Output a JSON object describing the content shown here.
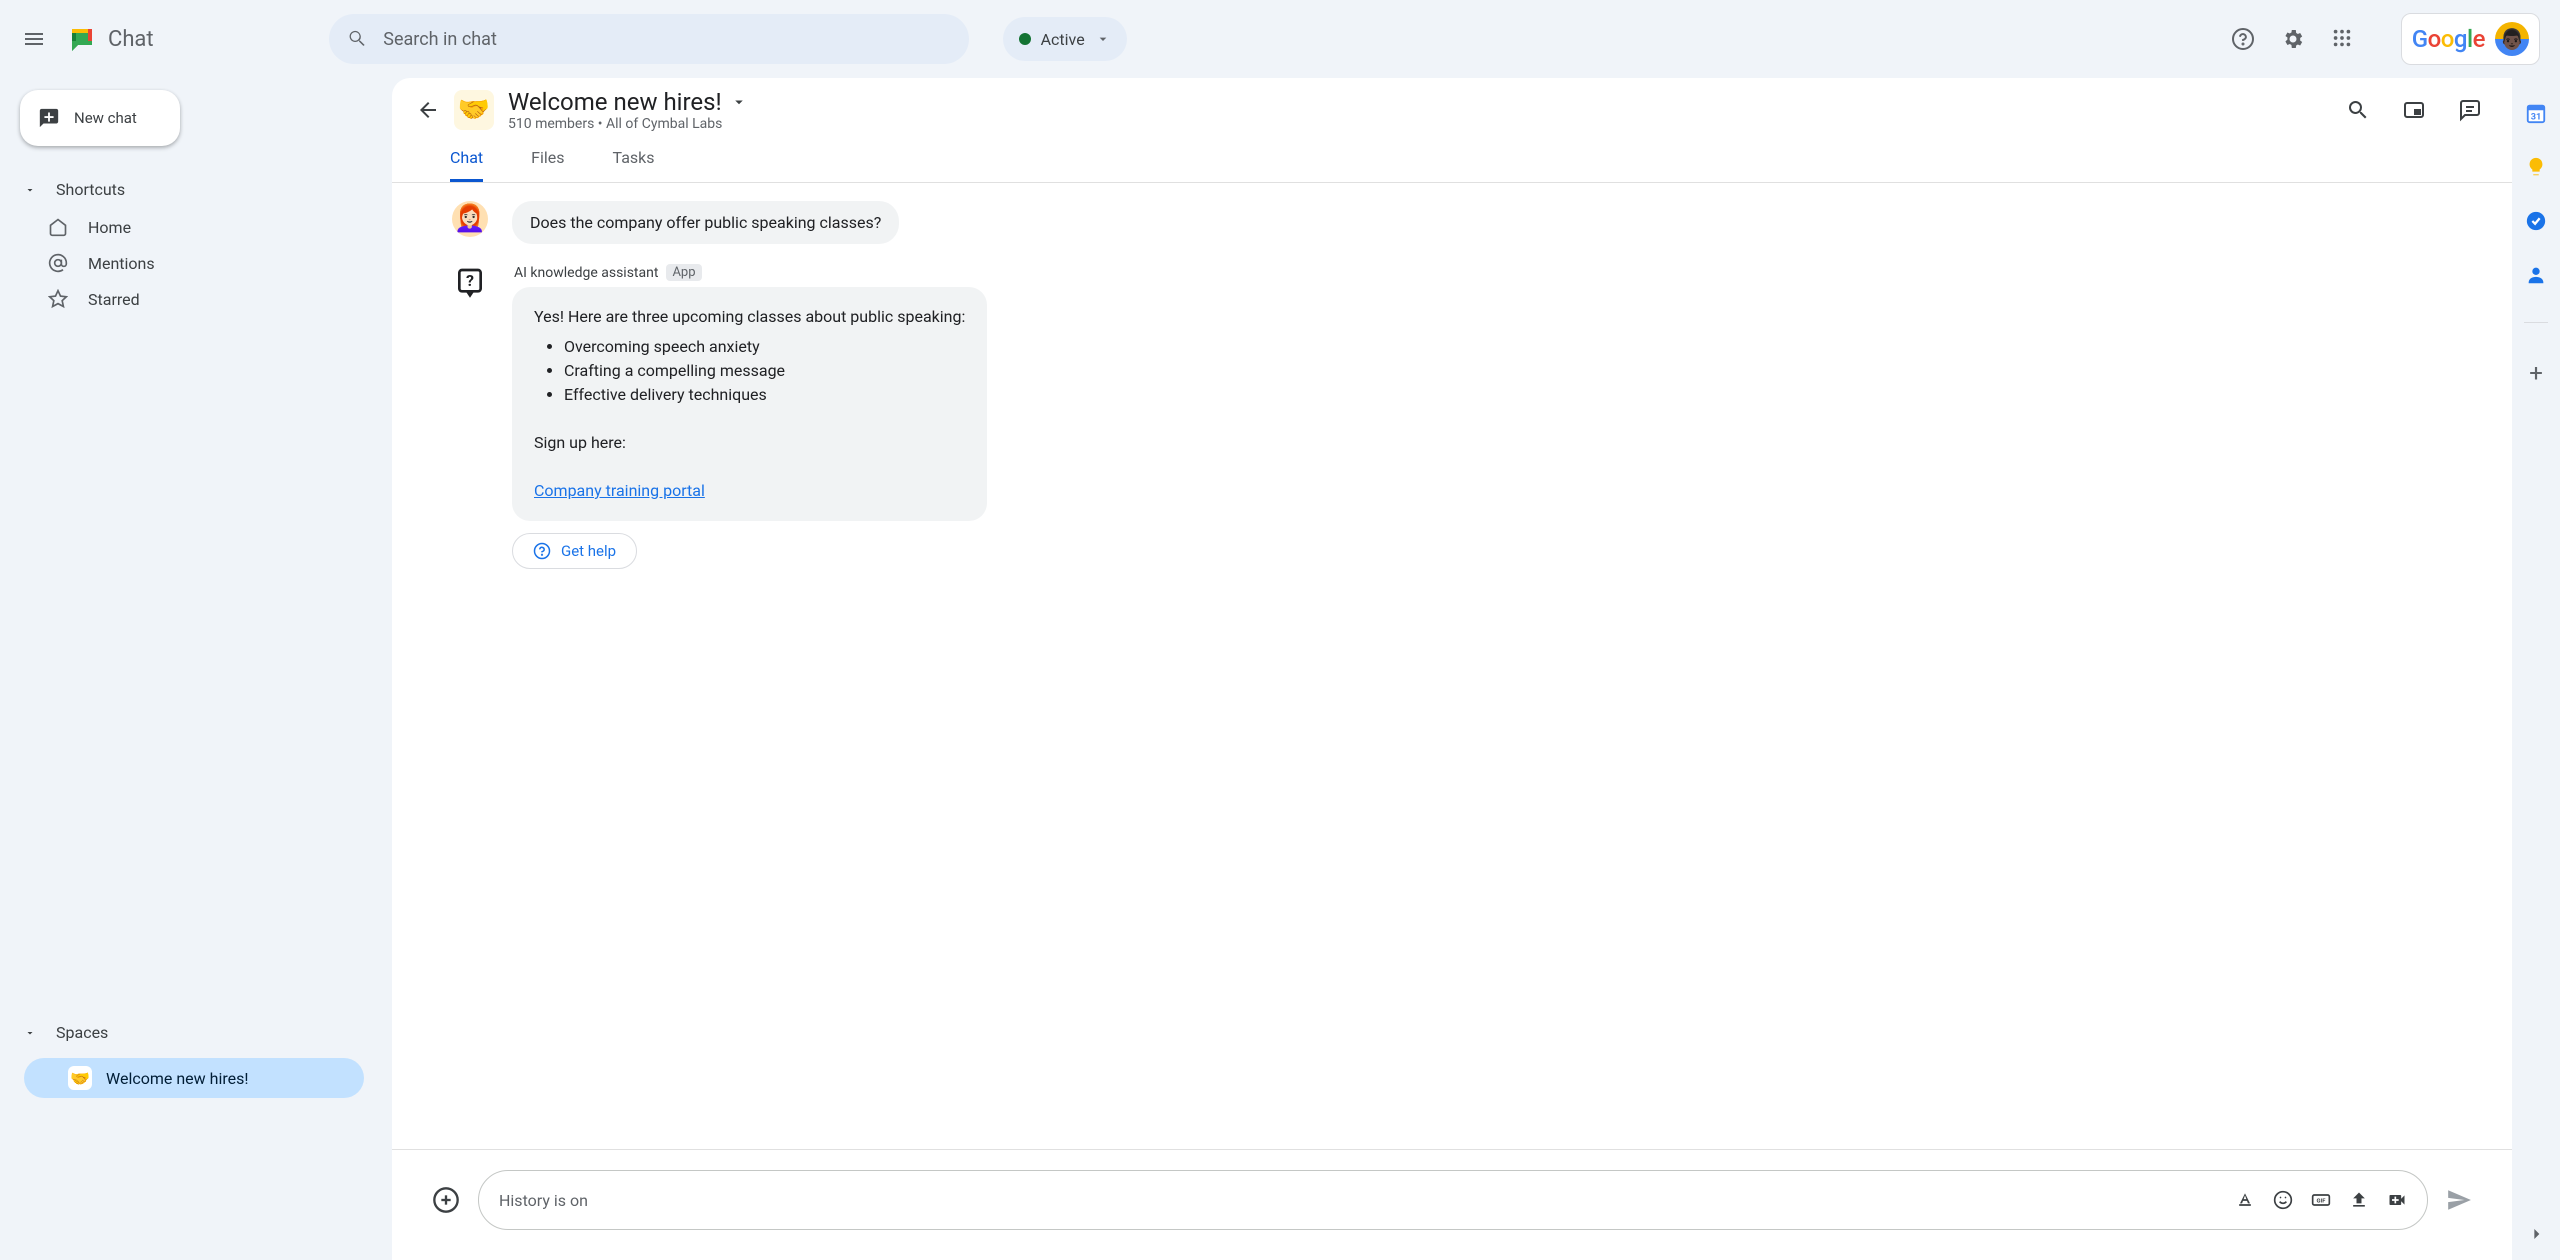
{
  "app": {
    "title": "Chat"
  },
  "header": {
    "search_placeholder": "Search in chat",
    "status": "Active"
  },
  "sidebar": {
    "new_chat": "New chat",
    "shortcuts_label": "Shortcuts",
    "items": [
      {
        "label": "Home"
      },
      {
        "label": "Mentions"
      },
      {
        "label": "Starred"
      }
    ],
    "spaces_label": "Spaces",
    "spaces": [
      {
        "label": "Welcome new hires!",
        "emoji": "🤝"
      }
    ]
  },
  "conversation": {
    "title": "Welcome new hires!",
    "subtitle": "510 members  •  All of Cymbal Labs",
    "emoji": "🤝",
    "tabs": [
      "Chat",
      "Files",
      "Tasks"
    ],
    "messages": {
      "user_q": "Does the company offer public speaking classes?",
      "bot_name": "AI knowledge assistant",
      "app_badge": "App",
      "bot_intro": "Yes! Here are three upcoming classes about public speaking:",
      "bot_items": [
        "Overcoming speech anxiety",
        "Crafting a compelling message",
        "Effective delivery techniques"
      ],
      "bot_signup": "Sign up here:",
      "bot_link": "Company training portal",
      "get_help": "Get help"
    },
    "composer_placeholder": "History is on"
  }
}
